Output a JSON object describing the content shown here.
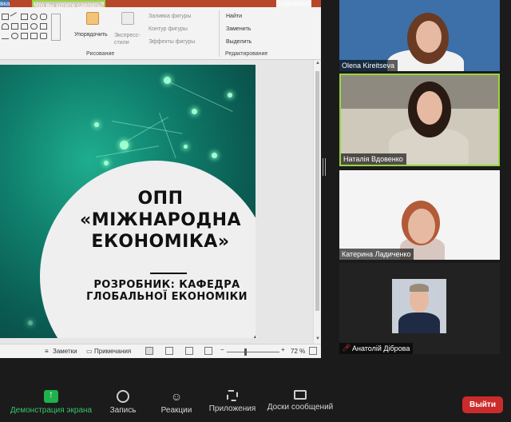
{
  "ribbon": {
    "tab_left": "вка",
    "search": "Что вы хотите сделать?",
    "share": "Поделиться",
    "arrange": "Упорядочить",
    "quick_styles": "Экспресс-стили",
    "shape_fill": "Заливка фигуры",
    "shape_outline": "Контур фигуры",
    "shape_effects": "Эффекты фигуры",
    "find": "Найти",
    "replace": "Заменить",
    "select": "Выделить",
    "group_drawing": "Рисование",
    "group_editing": "Редактирование"
  },
  "slide": {
    "title": "ОПП «МІЖНАРОДНА ЕКОНОМІКА»",
    "subtitle": "РОЗРОБНИК: КАФЕДРА ГЛОБАЛЬНОЇ ЕКОНОМІКИ"
  },
  "status_bar": {
    "notes": "Заметки",
    "comments": "Примечания",
    "zoom": "72 %"
  },
  "participants": [
    {
      "name": "Olena Kireitseva"
    },
    {
      "name": "Наталія Вдовенко"
    },
    {
      "name": "Катерина Ладиченко"
    },
    {
      "name": "Анатолій Діброва",
      "muted": true
    }
  ],
  "toolbar": {
    "share_screen": "Демонстрация экрана",
    "record": "Запись",
    "reactions": "Реакции",
    "apps": "Приложения",
    "whiteboard": "Доски сообщений",
    "leave": "Выйти"
  },
  "colors": {
    "accent_green": "#1fb14c",
    "leave_red": "#cc2b2b",
    "speaker_border": "#9ad43f",
    "ribbon_brand": "#b7472a"
  }
}
